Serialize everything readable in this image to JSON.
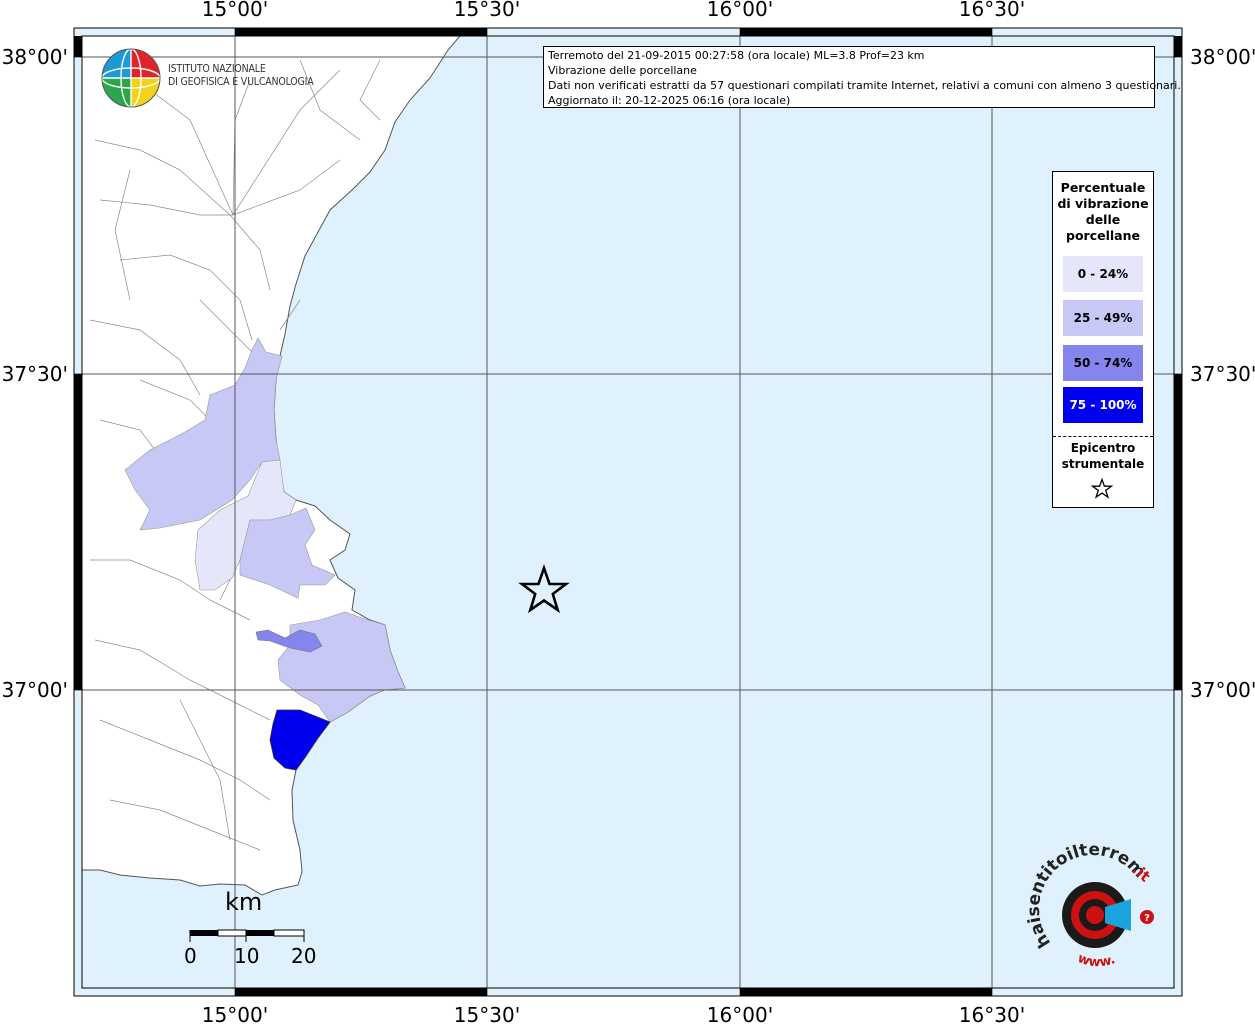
{
  "info": {
    "line1": "Terremoto del 21-09-2015 00:27:58 (ora locale) ML=3.8 Prof=23 km",
    "line2": "Vibrazione delle porcellane",
    "line3": "Dati non verificati estratti da 57 questionari compilati tramite Internet, relativi a comuni con almeno 3 questionari.",
    "line4": "Aggiornato il: 20-12-2025 06:16 (ora locale)"
  },
  "axes": {
    "lon_top": [
      "15°00'",
      "15°30'",
      "16°00'",
      "16°30'"
    ],
    "lon_bottom": [
      "15°00'",
      "15°30'",
      "16°00'",
      "16°30'"
    ],
    "lat_left": [
      "38°00'",
      "37°30'",
      "37°00'"
    ],
    "lat_right": [
      "38°00'",
      "37°30'",
      "37°00'"
    ]
  },
  "legend": {
    "title": [
      "Percentuale",
      "di vibrazione",
      "delle",
      "porcellane"
    ],
    "classes": [
      {
        "label": "0 - 24%",
        "color": "#e6e6fb"
      },
      {
        "label": "25 - 49%",
        "color": "#c8c8f7"
      },
      {
        "label": "50 - 74%",
        "color": "#8585ee"
      },
      {
        "label": "75 - 100%",
        "color": "#0000ee"
      }
    ],
    "epicenter_label": [
      "Epicentro",
      "strumentale"
    ]
  },
  "logo": {
    "line1": "ISTITUTO NAZIONALE",
    "line2": "DI GEOFISICA E VULCANOLOGIA"
  },
  "scale": {
    "title": "km",
    "labels": [
      "0",
      "10",
      "20"
    ]
  },
  "colors": {
    "sea": "#dff1fd",
    "land": "#ffffff",
    "class_0_24": "#e6e6fb",
    "class_25_49": "#c8c8f7",
    "class_50_74": "#8585ee",
    "class_75_100": "#0000ee",
    "hsit_red": "#cc1111",
    "hsit_blue": "#1aa3dd"
  },
  "watermark": {
    "text_main": "haisentitoilterremoto",
    "text_tld": ".it",
    "text_www": "www."
  }
}
